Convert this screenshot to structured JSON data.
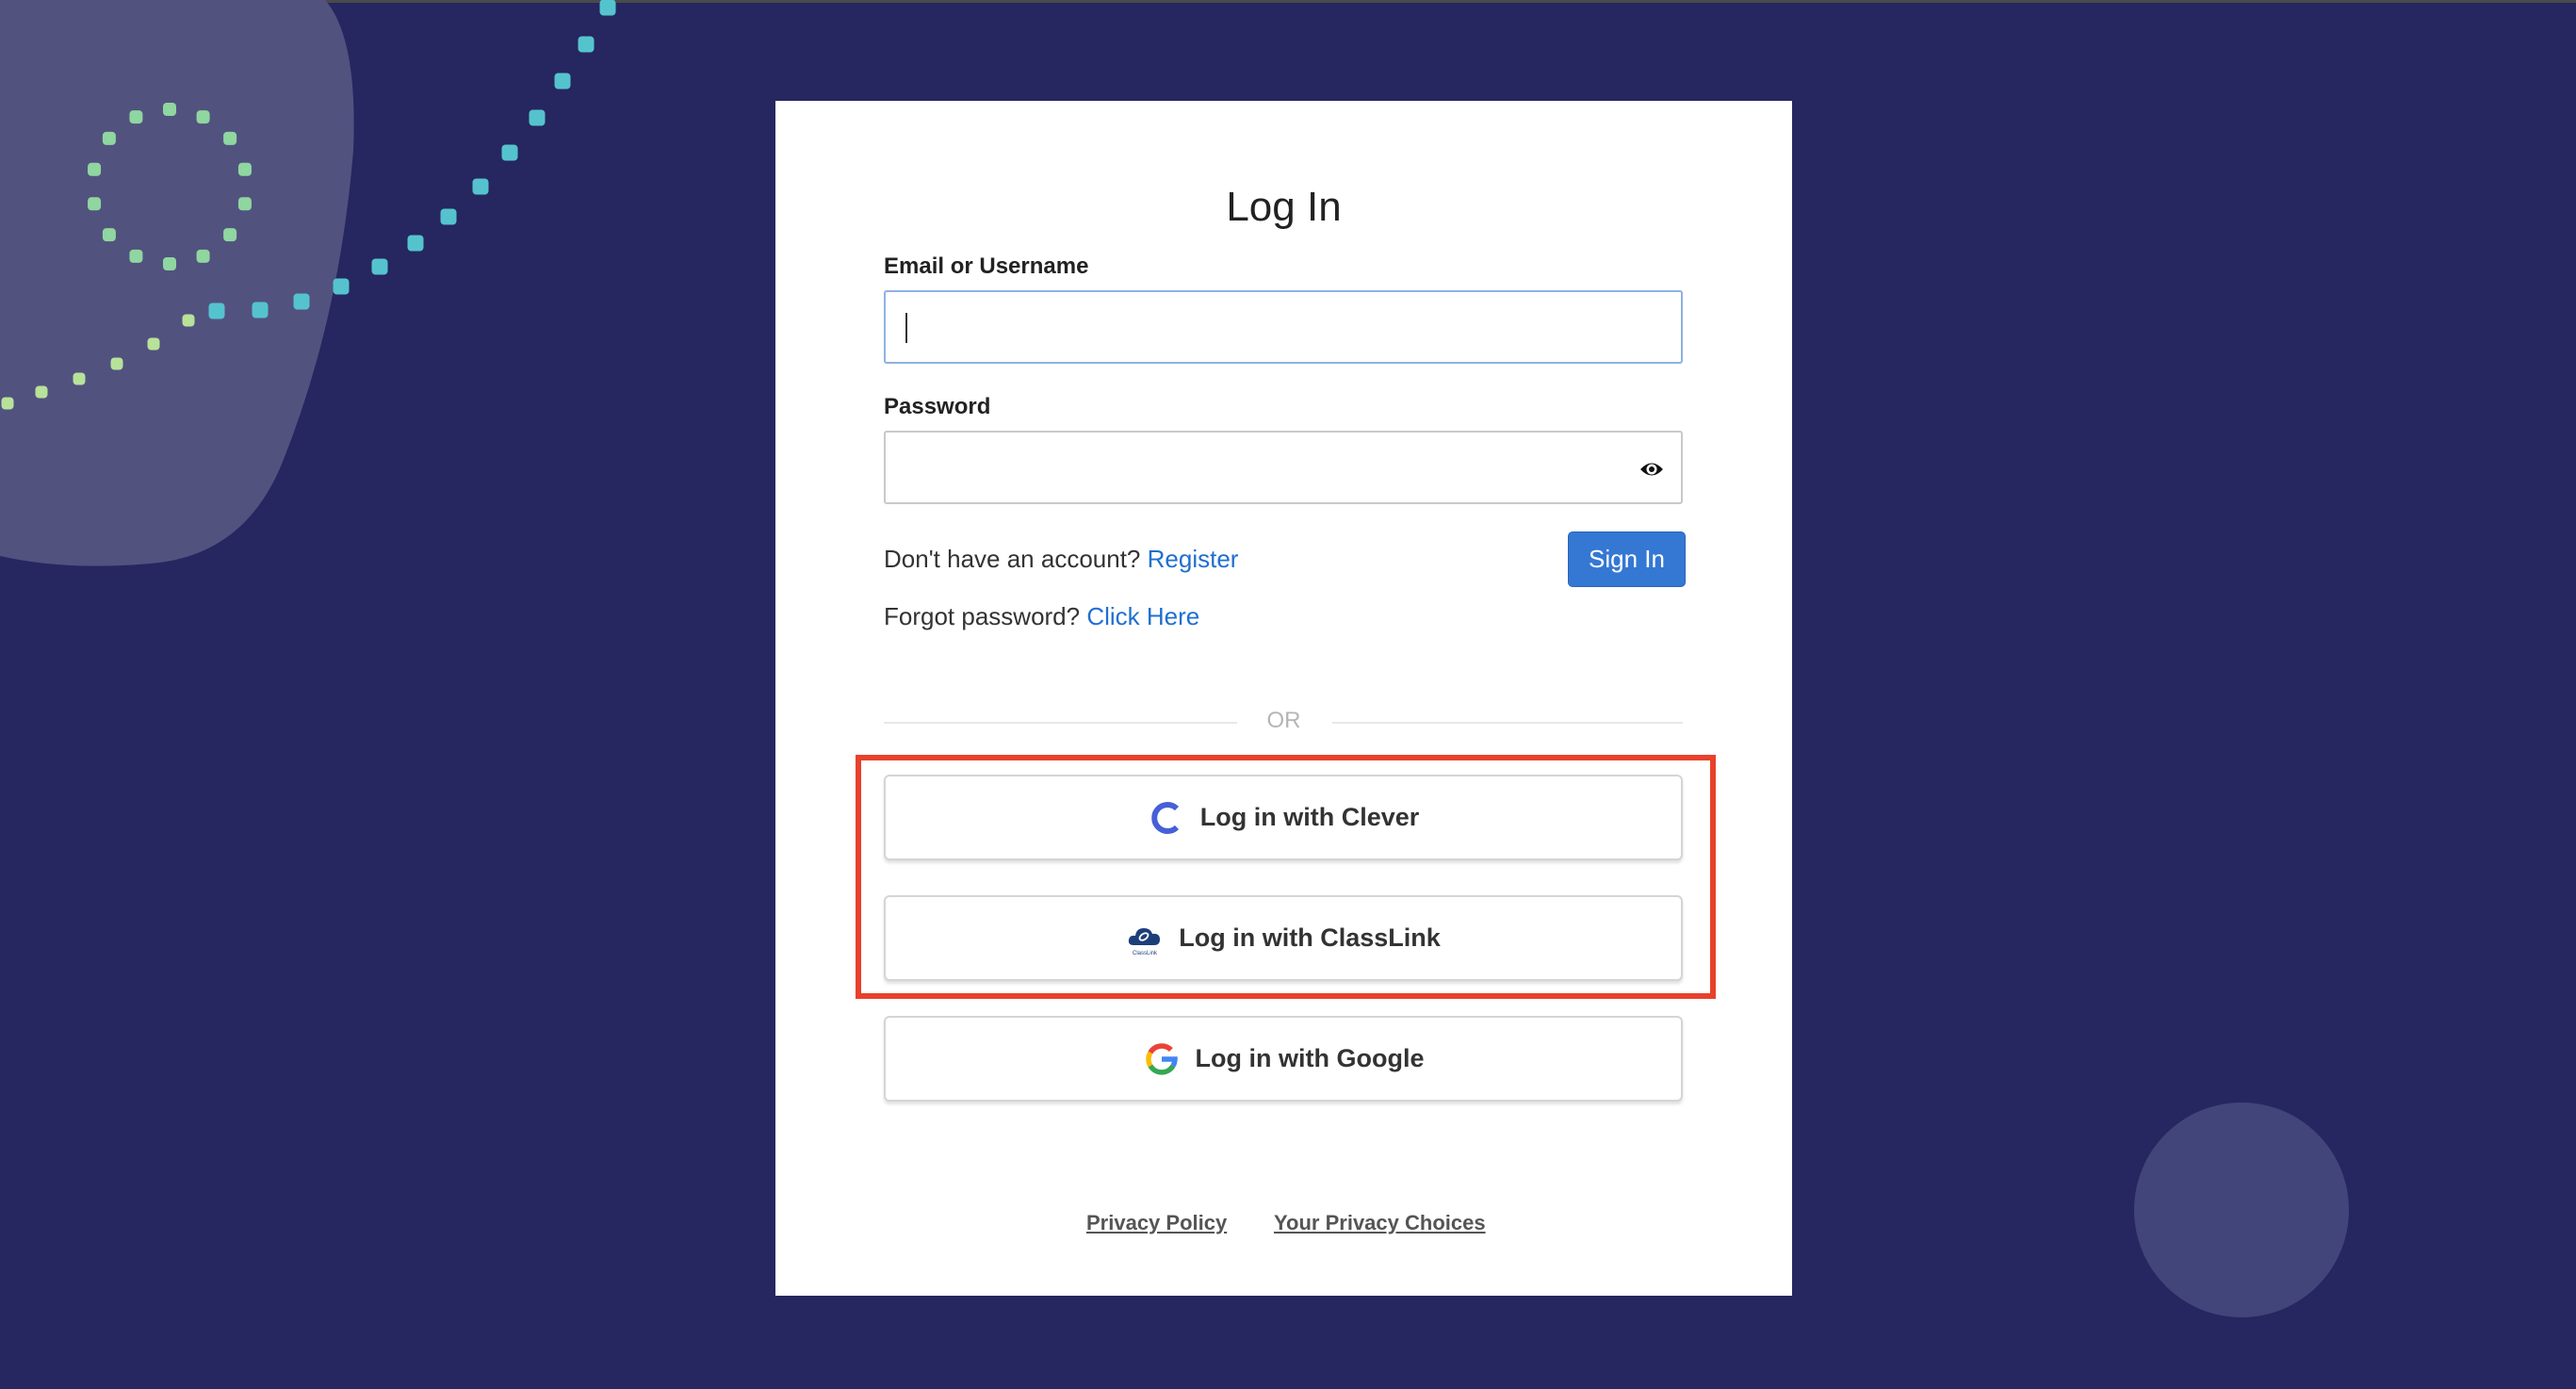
{
  "login": {
    "title": "Log In",
    "email_label": "Email or Username",
    "email_value": "",
    "password_label": "Password",
    "password_value": "",
    "no_account_text": "Don't have an account?",
    "register_link": "Register",
    "sign_in_button": "Sign In",
    "forgot_text": "Forgot password?",
    "forgot_link": "Click Here",
    "divider": "OR"
  },
  "sso": {
    "clever": "Log in with Clever",
    "classlink": "Log in with ClassLink",
    "classlink_logo_text": "ClassLink",
    "google": "Log in with Google"
  },
  "footer": {
    "privacy_policy": "Privacy Policy",
    "privacy_choices": "Your Privacy Choices"
  },
  "icons": {
    "password_toggle": "eye-icon",
    "clever": "clever-logo-icon",
    "classlink": "classlink-logo-icon",
    "google": "google-logo-icon"
  },
  "colors": {
    "background": "#262660",
    "primary_button": "#3478d4",
    "link": "#1f6fd0",
    "highlight_box": "#e8412c",
    "clever_brand": "#4560d8",
    "classlink_brand": "#1c3f7a"
  }
}
